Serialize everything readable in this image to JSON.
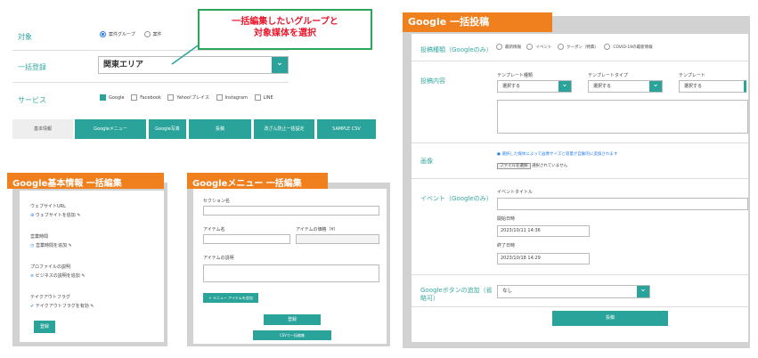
{
  "top": {
    "target_label": "対象",
    "target_options": [
      "案件グループ",
      "案件"
    ],
    "group_label": "一括登録",
    "group_select": "関東エリア",
    "service_label": "サービス",
    "services": [
      "Google",
      "Facebook",
      "Yahoo!プレイス",
      "Instagram",
      "LINE"
    ],
    "tabs": [
      "基本情報",
      "Googleメニュー",
      "Google写真",
      "投稿",
      "改ざん防止一括設定",
      "SAMPLE CSV"
    ],
    "callout_line1": "一括編集したいグループと",
    "callout_line2": "対象媒体を選択"
  },
  "basic_panel": {
    "banner": "Google基本情報 一括編集",
    "website_label": "ウェブサイトURL",
    "website_link": "ウェブサイトを追加",
    "hours_label": "営業時間",
    "hours_link": "営業時間を追加",
    "profile_label": "プロファイルの説明",
    "profile_link": "ビジネスの説明を追加",
    "takeout_label": "テイクアウトフラグ",
    "takeout_link": "テイクアウトフラグを有効",
    "register": "登録"
  },
  "menu_panel": {
    "banner": "Googleメニュー 一括編集",
    "section_name": "セクション名",
    "item_name": "アイテム名",
    "item_price": "アイテムの価格（¥）",
    "item_desc": "アイテムの説明",
    "add_item": "+ メニュー アイテムを追加",
    "register": "登録",
    "csv_button": "CSVで一括編集"
  },
  "post_panel": {
    "banner": "Google 一括投稿",
    "type_label": "投稿種類（Googleのみ）",
    "types": [
      "最新情報",
      "イベント",
      "クーポン（特典）",
      "COVID-19の最新情報"
    ],
    "content_label": "投稿内容",
    "tpl_kind_label": "テンプレート種類",
    "tpl_type_label": "テンプレートタイプ",
    "tpl_label": "テンプレート",
    "select_placeholder": "選択する",
    "image_label": "画像",
    "image_note": "選択した媒体によって画像サイズと容量が自動的に変換されます",
    "file_button": "ファイルを選択",
    "file_status": "選択されていません",
    "event_label": "イベント（Googleのみ）",
    "event_title": "イベントタイトル",
    "start_label": "開始日時",
    "start_value": "2023/10/11 14:36",
    "end_label": "終了日時",
    "end_value": "2023/10/18 14:29",
    "button_label": "Googleボタンの追加（省略可）",
    "button_value": "なし",
    "submit": "投稿"
  }
}
